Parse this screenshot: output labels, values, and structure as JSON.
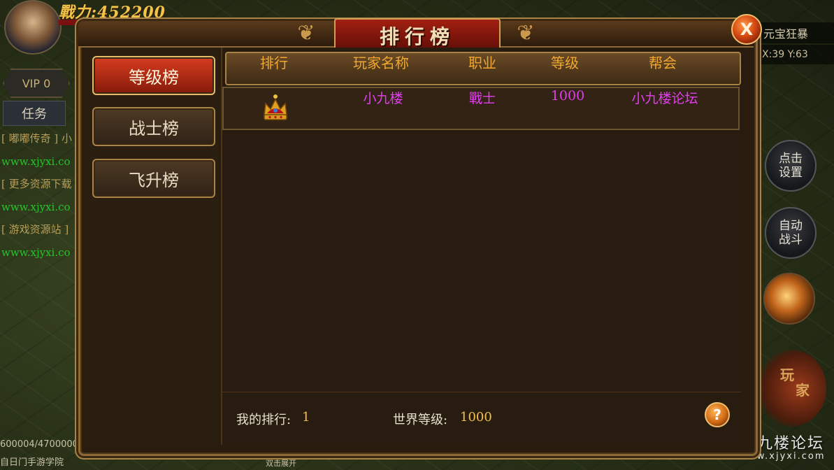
{
  "hud": {
    "power_text": "戰力:452200",
    "vip_label": "VIP 0",
    "task_label": "任务",
    "chat_lines": [
      {
        "text": "[ 嘟嘟传奇 ] 小",
        "color": "yellow"
      },
      {
        "text": "www.xjyxi.co",
        "color": "green"
      },
      {
        "text": "[ 更多资源下载",
        "color": "yellow"
      },
      {
        "text": "www.xjyxi.co",
        "color": "green"
      },
      {
        "text": "[ 游戏资源站 ]",
        "color": "yellow"
      },
      {
        "text": "www.xjyxi.co",
        "color": "green"
      }
    ],
    "exp_text": "600004/4700000",
    "academy_text": "自日门手游学院",
    "expand_text": "双击展开",
    "map_name": "元宝狂暴",
    "coords": "X:39 Y:63",
    "settings_btn": "点击设置",
    "auto_battle_btn": "自动战斗",
    "player_btn": [
      "玩",
      "家"
    ],
    "watermark": "小九楼论坛",
    "watermark_url": "www.xjyxi.com"
  },
  "panel": {
    "title": "排行榜",
    "close_label": "X",
    "tabs": [
      {
        "label": "等级榜",
        "active": true
      },
      {
        "label": "战士榜",
        "active": false
      },
      {
        "label": "飞升榜",
        "active": false
      }
    ],
    "columns": [
      "排行",
      "玩家名称",
      "职业",
      "等级",
      "帮会"
    ],
    "rows": [
      {
        "rank_icon": "crown-icon",
        "name": "小九楼",
        "class": "戰士",
        "level": "1000",
        "guild": "小九楼论坛"
      }
    ],
    "footer": {
      "my_rank_label": "我的排行:",
      "my_rank_value": "1",
      "world_level_label": "世界等级:",
      "world_level_value": "1000"
    },
    "help_label": "?"
  },
  "colors": {
    "accent_gold": "#a98345",
    "header_text": "#f0a830",
    "row_text": "#e43df0",
    "active_tab": "#d63d1f"
  }
}
